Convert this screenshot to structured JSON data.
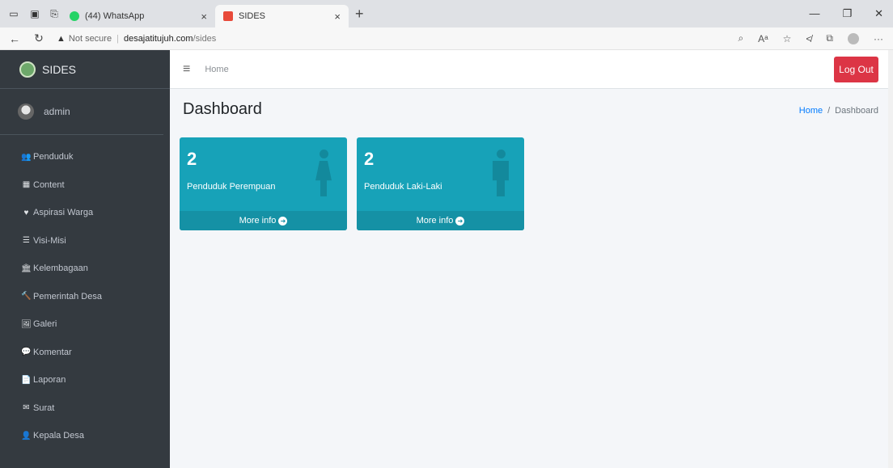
{
  "browser": {
    "tabs": [
      {
        "title": "(44) WhatsApp",
        "close": "×",
        "fav_color": "#25d366"
      },
      {
        "title": "SIDES",
        "close": "×",
        "fav_color": "#e84a3a"
      }
    ],
    "new_tab": "+",
    "address": {
      "warning": "Not secure",
      "separator": "|",
      "domain": "desajatitujuh.com",
      "path": "/sides"
    }
  },
  "sidebar": {
    "brand": "SIDES",
    "user": "admin",
    "items": [
      {
        "label": "Penduduk",
        "icon": "users-icon"
      },
      {
        "label": "Content",
        "icon": "table-icon"
      },
      {
        "label": "Aspirasi Warga",
        "icon": "heart-icon"
      },
      {
        "label": "Visi-Misi",
        "icon": "list-icon"
      },
      {
        "label": "Kelembagaan",
        "icon": "landmark-icon"
      },
      {
        "label": "Pemerintah Desa",
        "icon": "hammer-icon"
      },
      {
        "label": "Galeri",
        "icon": "images-icon"
      },
      {
        "label": "Komentar",
        "icon": "comment-icon"
      },
      {
        "label": "Laporan",
        "icon": "file-icon"
      },
      {
        "label": "Surat",
        "icon": "envelope-icon"
      },
      {
        "label": "Kepala Desa",
        "icon": "user-icon"
      }
    ]
  },
  "topnav": {
    "home": "Home",
    "logout": "Log Out"
  },
  "content": {
    "title": "Dashboard",
    "breadcrumb": {
      "home": "Home",
      "sep": "/",
      "current": "Dashboard"
    }
  },
  "boxes": [
    {
      "value": "2",
      "label": "Penduduk Perempuan",
      "more": "More info"
    },
    {
      "value": "2",
      "label": "Penduduk Laki-Laki",
      "more": "More info"
    }
  ],
  "colors": {
    "sidebar": "#343a40",
    "info_box": "#17a2b8",
    "logout": "#dc3545",
    "link": "#007bff"
  }
}
